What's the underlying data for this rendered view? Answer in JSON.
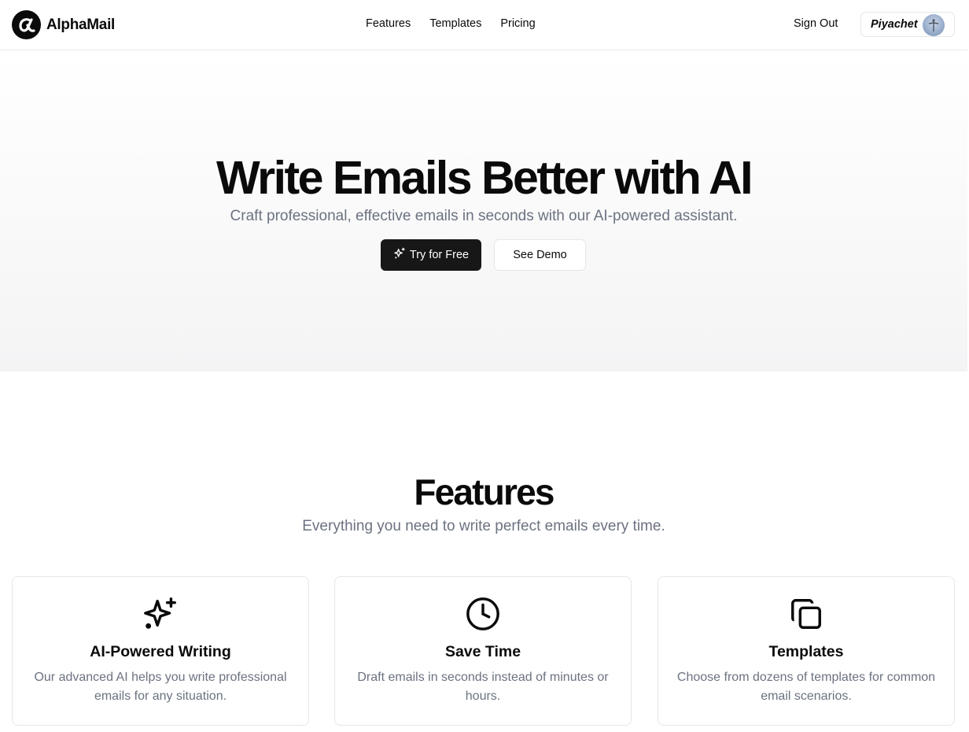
{
  "brand": {
    "name": "AlphaMail"
  },
  "nav": {
    "items": [
      "Features",
      "Templates",
      "Pricing"
    ]
  },
  "account": {
    "sign_out": "Sign Out",
    "user_name": "Piyachet"
  },
  "hero": {
    "title": "Write Emails Better with AI",
    "subtitle": "Craft professional, effective emails in seconds with our AI-powered assistant.",
    "primary_button": "Try for Free",
    "secondary_button": "See Demo"
  },
  "features": {
    "title": "Features",
    "subtitle": "Everything you need to write perfect emails every time.",
    "cards": [
      {
        "icon": "sparkles-icon",
        "title": "AI-Powered Writing",
        "description": "Our advanced AI helps you write professional emails for any situation."
      },
      {
        "icon": "clock-icon",
        "title": "Save Time",
        "description": "Draft emails in seconds instead of minutes or hours."
      },
      {
        "icon": "copy-icon",
        "title": "Templates",
        "description": "Choose from dozens of templates for common email scenarios."
      }
    ]
  },
  "colors": {
    "primary": "#171717",
    "muted_text": "#6b7280",
    "border": "#e5e7eb"
  }
}
